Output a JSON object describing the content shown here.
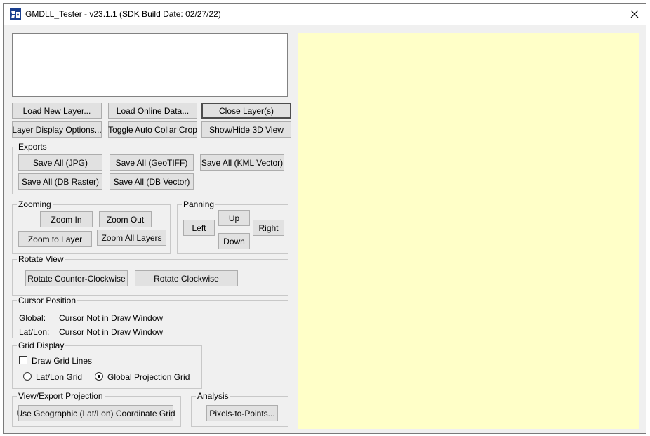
{
  "window": {
    "title": "GMDLL_Tester - v23.1.1 (SDK Build Date: 02/27/22)"
  },
  "colors": {
    "draw_window_bg": "#ffffc8",
    "accent": "#0078d7"
  },
  "top_buttons": {
    "load_new_layer": "Load New Layer...",
    "load_online_data": "Load Online Data...",
    "close_layers": "Close Layer(s)",
    "layer_display_options": "Layer Display Options...",
    "toggle_auto_collar_crop": "Toggle Auto Collar Crop",
    "show_hide_3d": "Show/Hide 3D View"
  },
  "exports": {
    "label": "Exports",
    "save_all_jpg": "Save All (JPG)",
    "save_all_geotiff": "Save All (GeoTIFF)",
    "save_all_kml": "Save All (KML Vector)",
    "save_all_db_raster": "Save All (DB Raster)",
    "save_all_db_vector": "Save All (DB Vector)"
  },
  "zooming": {
    "label": "Zooming",
    "zoom_in": "Zoom In",
    "zoom_out": "Zoom Out",
    "zoom_to_layer": "Zoom to Layer",
    "zoom_all_layers": "Zoom All Layers"
  },
  "panning": {
    "label": "Panning",
    "up": "Up",
    "left": "Left",
    "right": "Right",
    "down": "Down"
  },
  "rotate_view": {
    "label": "Rotate View",
    "ccw": "Rotate Counter-Clockwise",
    "cw": "Rotate Clockwise"
  },
  "cursor_position": {
    "label": "Cursor Position",
    "global_label": "Global:",
    "global_value": "Cursor Not in Draw Window",
    "latlon_label": "Lat/Lon:",
    "latlon_value": "Cursor Not in Draw Window"
  },
  "grid_display": {
    "label": "Grid Display",
    "draw_grid_lines": "Draw Grid Lines",
    "draw_grid_lines_checked": false,
    "latlon_grid": "Lat/Lon Grid",
    "global_projection_grid": "Global Projection Grid",
    "selected": "Global Projection Grid"
  },
  "view_export_projection": {
    "label": "View/Export Projection",
    "button": "Use Geographic (Lat/Lon) Coordinate Grid"
  },
  "analysis": {
    "label": "Analysis",
    "button": "Pixels-to-Points..."
  }
}
